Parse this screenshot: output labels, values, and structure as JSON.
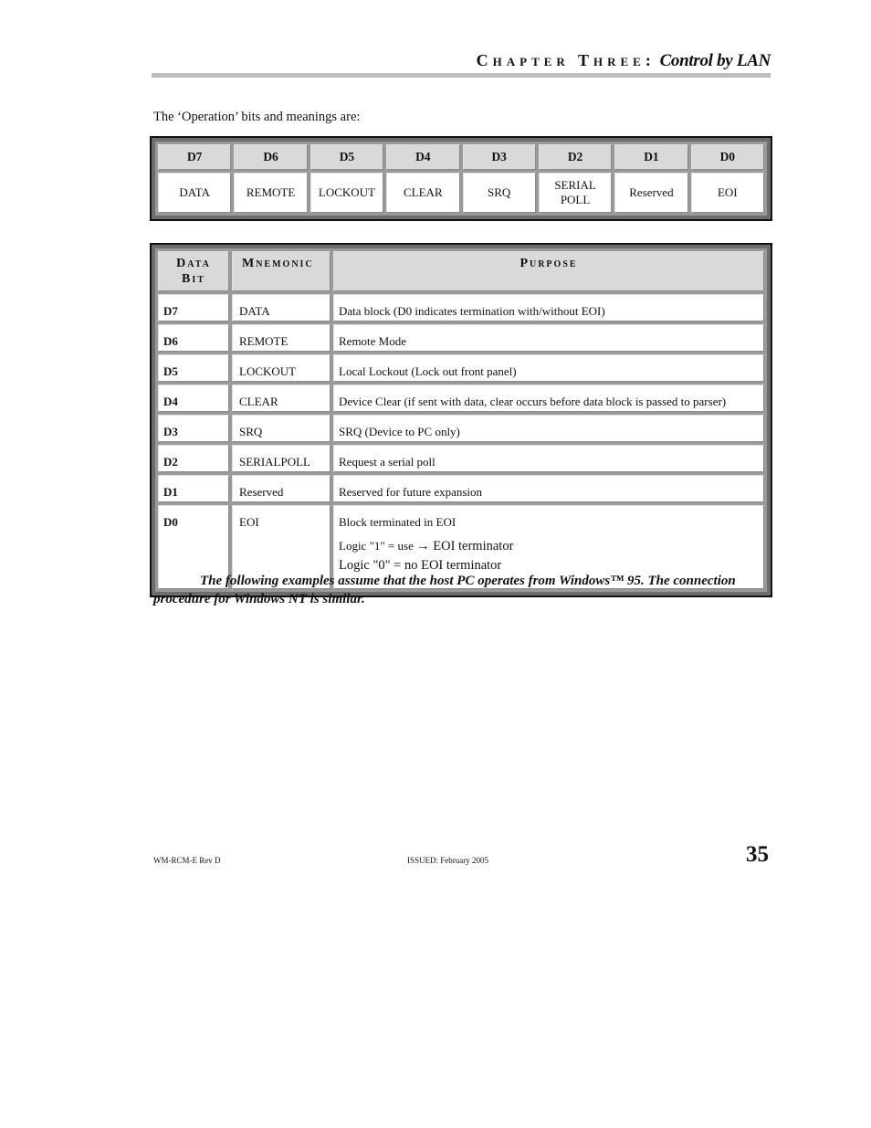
{
  "header": {
    "chapter": "Chapter Three:",
    "title": "Control by LAN"
  },
  "intro": "The ‘Operation’ bits and meanings are:",
  "bits_table": {
    "headers": [
      "D7",
      "D6",
      "D5",
      "D4",
      "D3",
      "D2",
      "D1",
      "D0"
    ],
    "values": [
      {
        "line1": "DATA",
        "line2": ""
      },
      {
        "line1": "REMOTE",
        "line2": ""
      },
      {
        "line1": "LOCKOUT",
        "line2": ""
      },
      {
        "line1": "CLEAR",
        "line2": ""
      },
      {
        "line1": "SRQ",
        "line2": ""
      },
      {
        "line1": "SERIAL",
        "line2": "POLL"
      },
      {
        "line1": "Reserved",
        "line2": ""
      },
      {
        "line1": "EOI",
        "line2": ""
      }
    ]
  },
  "purpose_table": {
    "headers": {
      "data_bit_line1": "Data",
      "data_bit_line2": "Bit",
      "mnemonic": "Mnemonic",
      "purpose": "Purpose"
    },
    "rows": [
      {
        "bit": "D7",
        "mnemonic": "DATA",
        "purpose": "Data block (D0 indicates termination with/without EOI)"
      },
      {
        "bit": "D6",
        "mnemonic": "REMOTE",
        "purpose": "Remote Mode"
      },
      {
        "bit": "D5",
        "mnemonic": "LOCKOUT",
        "purpose": "Local Lockout (Lock out front panel)"
      },
      {
        "bit": "D4",
        "mnemonic": "CLEAR",
        "purpose": "Device Clear (if sent with data, clear occurs before data block is passed to parser)"
      },
      {
        "bit": "D3",
        "mnemonic": "SRQ",
        "purpose": "SRQ (Device to PC only)"
      },
      {
        "bit": "D2",
        "mnemonic": "SERIALPOLL",
        "purpose": "Request a serial poll"
      },
      {
        "bit": "D1",
        "mnemonic": "Reserved",
        "purpose": "Reserved for future expansion"
      }
    ],
    "last_row": {
      "bit": "D0",
      "mnemonic": "EOI",
      "purpose_line1": "Block terminated in EOI",
      "purpose_line2_a": "Logic \"1\" = use ",
      "purpose_line2_arrow": "→",
      "purpose_line2_b": " EOI terminator",
      "purpose_line3": "Logic \"0\" = no EOI terminator"
    }
  },
  "note": "The following examples assume that the host PC operates from Windows™ 95. The connection procedure for Windows NT is similar.",
  "footer": {
    "doc_id": "WM-RCM-E Rev D",
    "issued": "ISSUED: February 2005",
    "page_number": "35"
  }
}
